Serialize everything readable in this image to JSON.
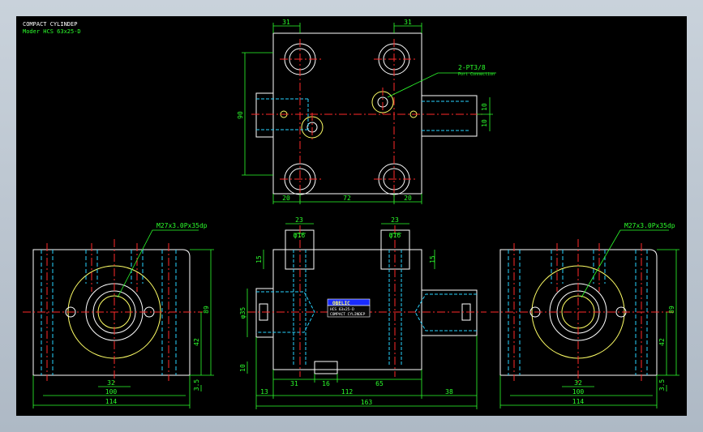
{
  "title_block": {
    "line1": "COMPACT CYLINDEP",
    "line2": "Moder HCS 63x25-D"
  },
  "colors": {
    "canvas": "#000000",
    "outline": "#ffffff",
    "dimension": "#2cff2c",
    "centerline": "#ff2a2a",
    "hidden": "#29d3ff",
    "highlight": "#ffff66",
    "nameplate": "#1a2cff"
  },
  "top_view": {
    "dim_top_left": "31",
    "dim_top_right": "31",
    "dim_height": "90",
    "dim_bottom_left": "20",
    "dim_bottom_mid": "72",
    "dim_bottom_right": "20",
    "dim_right_a": "10",
    "dim_right_b": "10",
    "port_label": "2-PT3/8",
    "port_note": "Port Connection"
  },
  "left_view": {
    "thread_label": "M27x3.0Px35dp",
    "dim_height": "89",
    "dim_mid": "42",
    "dim_low": "3.5",
    "dim_inner": "32",
    "dim_mid_width": "100",
    "dim_width": "114"
  },
  "front_view": {
    "dim_boss_left": "23",
    "dim_boss_right": "23",
    "dim_dia_left": "φ16",
    "dim_dia_right": "φ16",
    "dim_15_left": "15",
    "dim_15_right": "15",
    "dim_bore": "φ35",
    "dim_10": "10",
    "dim_31": "31",
    "dim_16": "16",
    "dim_65": "65",
    "dim_13": "13",
    "dim_112": "112",
    "dim_38": "38",
    "dim_163": "163",
    "nameplate_brand": "OBELIC",
    "nameplate_model": "HCS 63x25-D",
    "nameplate_type": "COMPACT CYLINDEP"
  },
  "right_view": {
    "thread_label": "M27x3.0Px35dp",
    "dim_height": "89",
    "dim_mid": "42",
    "dim_low": "3.5",
    "dim_inner": "32",
    "dim_mid_width": "100",
    "dim_width": "114"
  }
}
